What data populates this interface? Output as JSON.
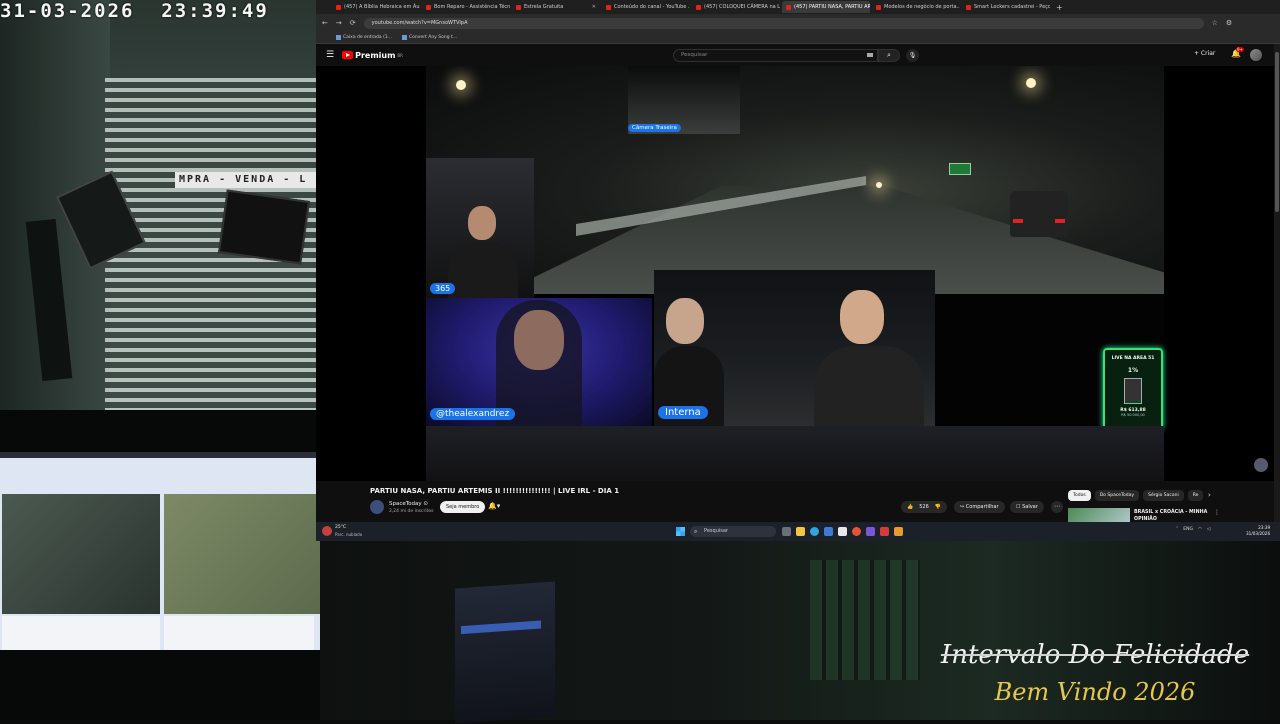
{
  "overlay": {
    "timestamp": "31-03-2026  23:39:49",
    "title": "Intervalo Do Felicidade",
    "subtitle": "Bem Vindo 2026",
    "store_sign": "MPRA - VENDA - L"
  },
  "browser": {
    "tabs": [
      {
        "label": "(457) A Bíblia Hebraica em Áu...",
        "active": false
      },
      {
        "label": "Bom Reparo - Assistência Técn...",
        "active": false
      },
      {
        "label": "Estrela Gratuita",
        "active": false
      },
      {
        "label": "Conteúdo do canal - YouTube ...",
        "active": false
      },
      {
        "label": "(457) COLOQUEI CÂMERA na L...",
        "active": false
      },
      {
        "label": "(457) PARTIU NASA, PARTIU AR...",
        "active": true
      },
      {
        "label": "Modelos de negócio de porta...",
        "active": false
      },
      {
        "label": "Smart Lockers cadastrei - Peço...",
        "active": false
      }
    ],
    "new_tab": "+",
    "url": "youtube.com/watch?v=MGnsoWTVIpA",
    "bookmarks": [
      {
        "label": "Caixa de entrada (1..."
      },
      {
        "label": "Convert Any Song t..."
      }
    ]
  },
  "youtube": {
    "logo_text": "Premium",
    "logo_region": "BR",
    "search_placeholder": "Pesquisar",
    "create_label": "+ Criar",
    "notification_count": "9+",
    "player": {
      "rear_camera_label": "Câmera Traseira",
      "cam1_label": "365",
      "cam2_label": "@thealexandrez",
      "cam3_label": "Interna",
      "live_widget": {
        "title": "LIVE NA AREA 51",
        "percent": "1%",
        "percent_value": 1,
        "amount": "R$ 613,88",
        "goal": "R$ 50.000,00"
      }
    },
    "video": {
      "title": "PARTIU NASA, PARTIU ARTEMIS II !!!!!!!!!!!!!!! | LIVE IRL - DIA 1",
      "channel": "SpaceToday",
      "verified": "⊙",
      "subscribers": "2,24 mi de inscritos",
      "join_label": "Seja membro",
      "likes": "526",
      "share_label": "Compartilhar",
      "save_label": "Salvar",
      "more_label": "⋯"
    },
    "chips": [
      {
        "label": "Todos",
        "active": true
      },
      {
        "label": "Do SpaceToday",
        "active": false
      },
      {
        "label": "Sérgio Sacani",
        "active": false
      },
      {
        "label": "Re",
        "active": false
      }
    ],
    "recommendation": {
      "title": "BRASIL x CROÁCIA - MINHA OPINIÃO"
    }
  },
  "taskbar": {
    "weather_temp": "25°C",
    "weather_desc": "Parc. nublado",
    "search_label": "Pesquisar",
    "language": "ENG",
    "time": "23:39",
    "date": "31/03/2026"
  },
  "colors": {
    "accent_blue": "#1a73e8",
    "youtube_red": "#ff0000",
    "widget_green": "#3ce07a",
    "subtitle_gold": "#e6c84a"
  }
}
